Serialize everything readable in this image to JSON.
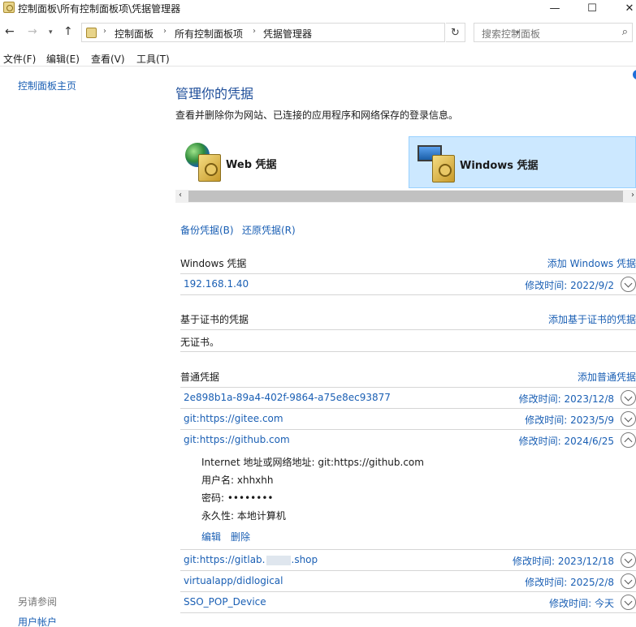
{
  "window": {
    "title": "控制面板\\所有控制面板项\\凭据管理器",
    "minimize": "—",
    "maximize": "☐",
    "close": "✕"
  },
  "address": {
    "crumbs": [
      "控制面板",
      "所有控制面板项",
      "凭据管理器"
    ],
    "search_placeholder": "搜索控制面板"
  },
  "menu": [
    "文件(F)",
    "编辑(E)",
    "查看(V)",
    "工具(T)"
  ],
  "sidebar": {
    "home": "控制面板主页",
    "see_also": "另请参阅",
    "user_accounts": "用户帐户"
  },
  "main": {
    "title": "管理你的凭据",
    "description": "查看并删除你为网站、已连接的应用程序和网络保存的登录信息。",
    "categories": [
      {
        "label": "Web 凭据",
        "selected": false
      },
      {
        "label": "Windows 凭据",
        "selected": true
      }
    ],
    "backup": "备份凭据(B)",
    "restore": "还原凭据(R)"
  },
  "windows_section": {
    "heading": "Windows 凭据",
    "add": "添加 Windows 凭据",
    "items": [
      {
        "name": "192.168.1.40",
        "modified": "修改时间:  2022/9/2"
      }
    ]
  },
  "cert_section": {
    "heading": "基于证书的凭据",
    "add": "添加基于证书的凭据",
    "empty": "无证书。"
  },
  "generic_section": {
    "heading": "普通凭据",
    "add": "添加普通凭据",
    "items": [
      {
        "name": "2e898b1a-89a4-402f-9864-a75e8ec93877",
        "modified": "修改时间:  2023/12/8"
      },
      {
        "name": "git:https://gitee.com",
        "modified": "修改时间:  2023/5/9"
      },
      {
        "name": "git:https://github.com",
        "modified": "修改时间:  2024/6/25",
        "expanded": true
      },
      {
        "name_prefix": "git:https://gitlab.",
        "name_suffix": ".shop",
        "modified": "修改时间:  2023/12/18"
      },
      {
        "name": "virtualapp/didlogical",
        "modified": "修改时间:  2025/2/8"
      },
      {
        "name": "SSO_POP_Device",
        "modified": "修改时间:  今天"
      }
    ],
    "detail": {
      "address": "Internet 地址或网络地址:  git:https://github.com",
      "username": "用户名:  xhhxhh",
      "password": "密码:  ••••••••",
      "persistence": "永久性:  本地计算机",
      "edit": "编辑",
      "delete": "删除"
    }
  }
}
